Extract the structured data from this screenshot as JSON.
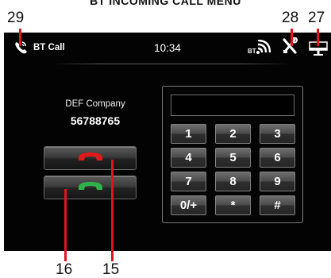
{
  "heading": "BT INCOMING CALL MENU",
  "callouts": {
    "c29": "29",
    "c28": "28",
    "c27": "27",
    "c16": "16",
    "c15": "15"
  },
  "status_bar": {
    "icon": "bluetooth-phone-icon",
    "title": "BT Call",
    "time": "10:34",
    "right_icons": [
      "bt-signal-icon",
      "settings-tools-icon",
      "screen-off-icon"
    ]
  },
  "caller": {
    "name": "DEF Company",
    "number": "56788765"
  },
  "call_buttons": {
    "reject": {
      "icon": "hang-up-icon",
      "color": "#e01a1a"
    },
    "answer": {
      "icon": "answer-call-icon",
      "color": "#2fb34a"
    }
  },
  "keypad": {
    "display_value": "",
    "keys": [
      "1",
      "2",
      "3",
      "4",
      "5",
      "6",
      "7",
      "8",
      "9",
      "0/+",
      "*",
      "#"
    ]
  },
  "colors": {
    "screen_bg": "#030303",
    "callout_line": "#e0141e"
  }
}
